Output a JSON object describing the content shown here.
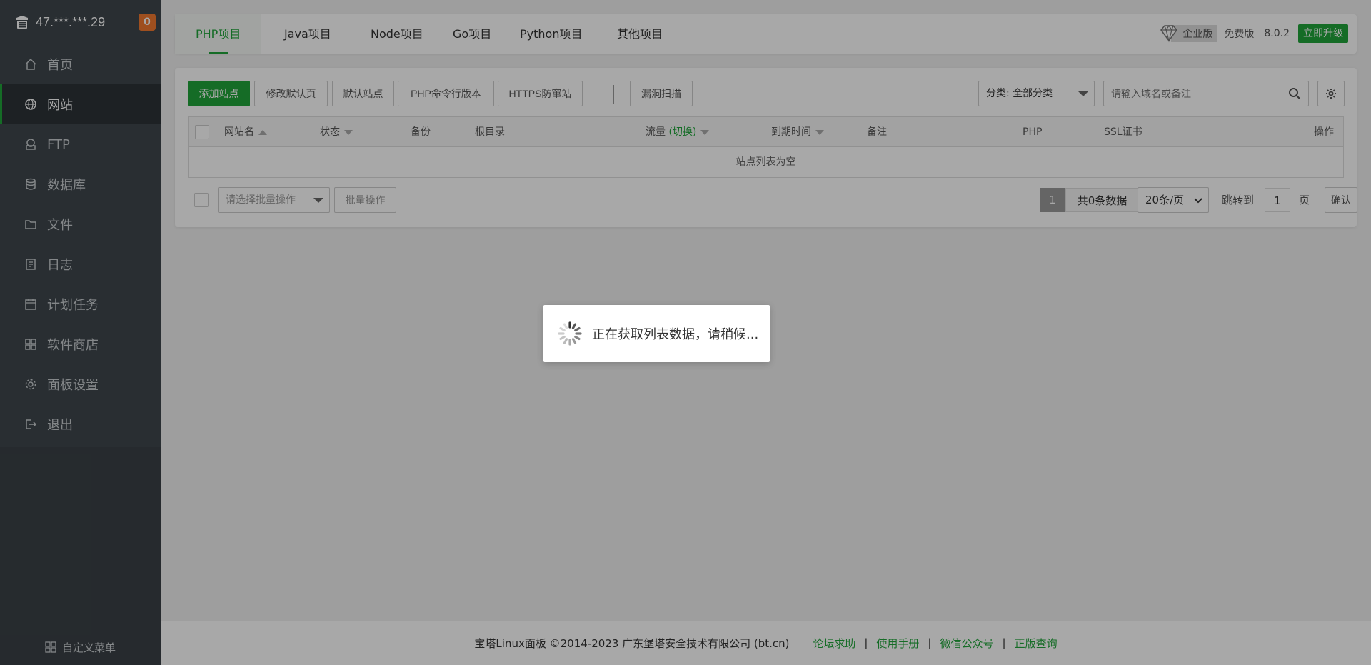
{
  "sidebar": {
    "ip": "47.***.***.29",
    "badge": "0",
    "items": [
      {
        "label": "首页",
        "icon": "home-icon"
      },
      {
        "label": "网站",
        "icon": "globe-icon",
        "active": true
      },
      {
        "label": "FTP",
        "icon": "ftp-icon"
      },
      {
        "label": "数据库",
        "icon": "database-icon"
      },
      {
        "label": "文件",
        "icon": "folder-icon"
      },
      {
        "label": "日志",
        "icon": "log-icon"
      },
      {
        "label": "计划任务",
        "icon": "calendar-icon"
      },
      {
        "label": "软件商店",
        "icon": "apps-icon"
      },
      {
        "label": "面板设置",
        "icon": "gear-icon"
      },
      {
        "label": "退出",
        "icon": "logout-icon"
      }
    ],
    "custom_menu": "自定义菜单"
  },
  "tabs": [
    "PHP项目",
    "Java项目",
    "Node项目",
    "Go项目",
    "Python项目",
    "其他项目"
  ],
  "edition": {
    "enterprise": "企业版",
    "free": "免费版",
    "version": "8.0.2",
    "upgrade": "立即升级"
  },
  "toolbar": {
    "add_site": "添加站点",
    "modify_default_page": "修改默认页",
    "default_site": "默认站点",
    "php_cli_version": "PHP命令行版本",
    "https_protect": "HTTPS防窜站",
    "vuln_scan": "漏洞扫描",
    "category_select": "分类: 全部分类",
    "search_placeholder": "请输入域名或备注"
  },
  "table": {
    "columns": {
      "name": "网站名",
      "status": "状态",
      "backup": "备份",
      "root": "根目录",
      "traffic": "流量",
      "traffic_switch": "(切换)",
      "expire": "到期时间",
      "remark": "备注",
      "php": "PHP",
      "ssl": "SSL证书",
      "action": "操作"
    },
    "empty_text": "站点列表为空"
  },
  "batch": {
    "placeholder": "请选择批量操作",
    "button": "批量操作"
  },
  "pager": {
    "current": "1",
    "total": "共0条数据",
    "per_page": "20条/页",
    "jump_label": "跳转到",
    "jump_value": "1",
    "page_unit": "页",
    "confirm": "确认"
  },
  "footer": {
    "copyright": "宝塔Linux面板 ©2014-2023 广东堡塔安全技术有限公司 (bt.cn)",
    "links": [
      "论坛求助",
      "使用手册",
      "微信公众号",
      "正版查询"
    ]
  },
  "loading": {
    "text": "正在获取列表数据，请稍候..."
  }
}
